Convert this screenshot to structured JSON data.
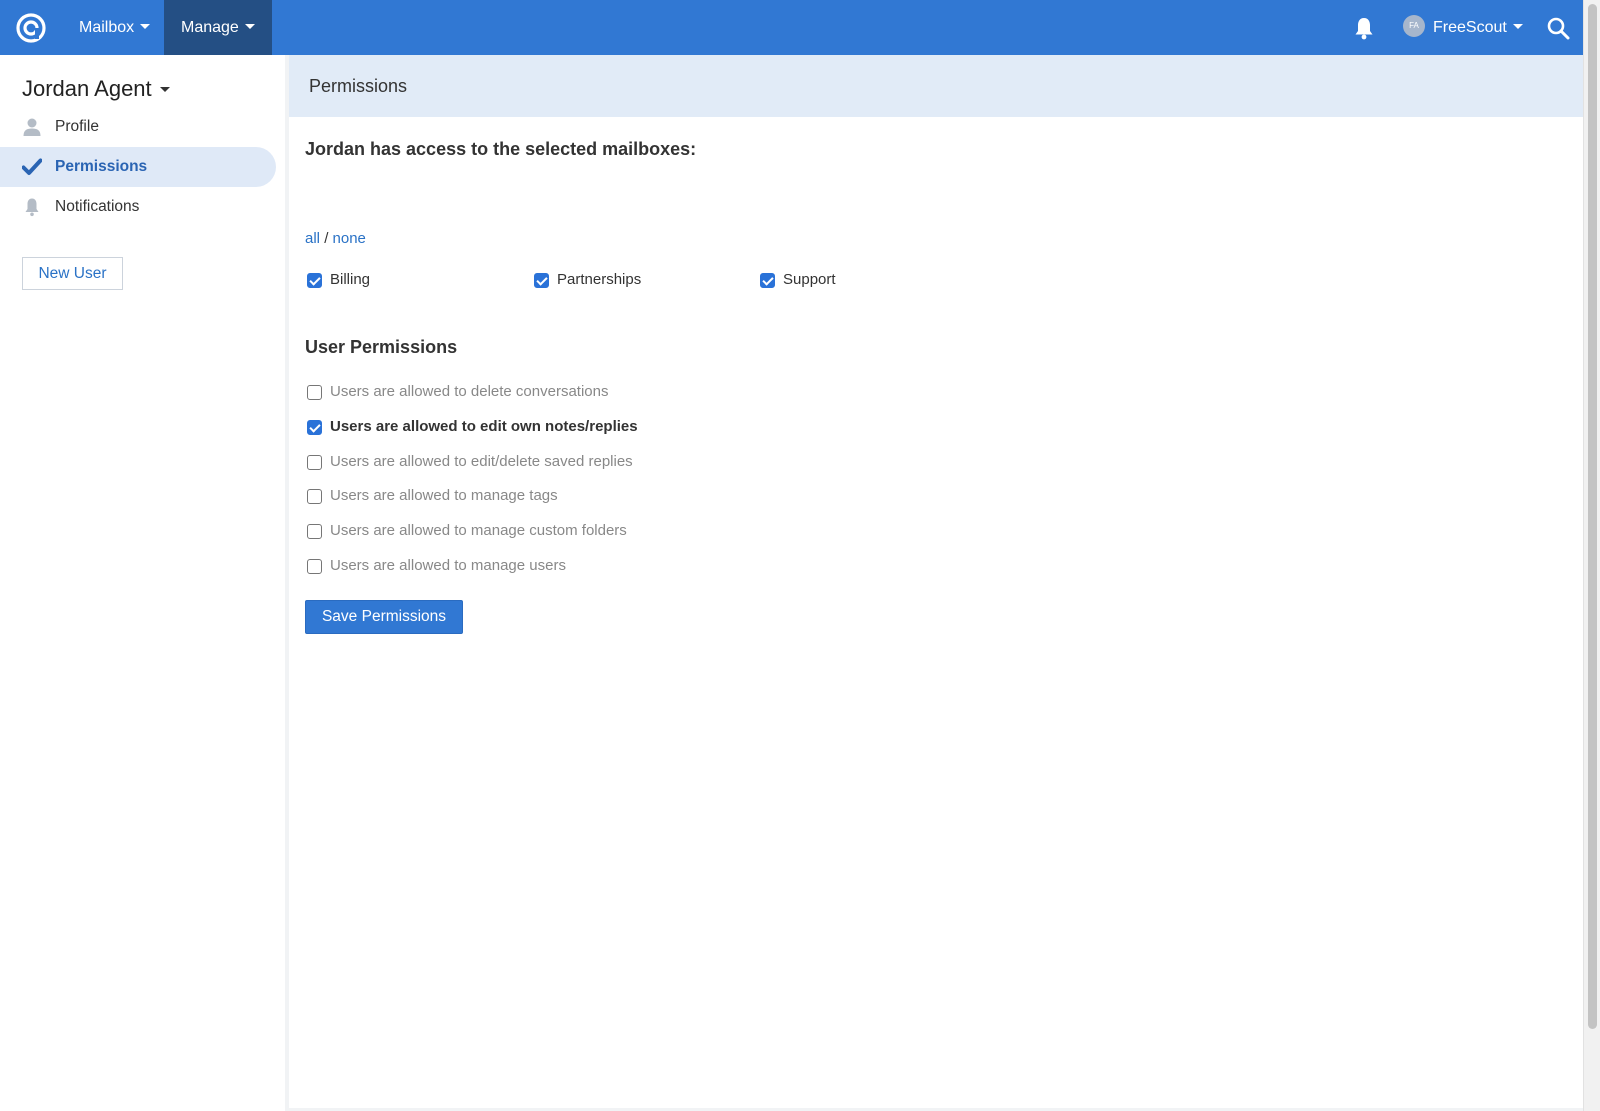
{
  "navbar": {
    "mailbox_label": "Mailbox",
    "manage_label": "Manage",
    "user_initials": "FA",
    "user_name": "FreeScout"
  },
  "sidebar": {
    "title": "Jordan Agent",
    "items": [
      {
        "label": "Profile",
        "icon": "user-icon",
        "active": false
      },
      {
        "label": "Permissions",
        "icon": "checkmark-icon",
        "active": true
      },
      {
        "label": "Notifications",
        "icon": "bell-icon",
        "active": false
      }
    ],
    "new_user_label": "New User"
  },
  "main": {
    "header": "Permissions",
    "mailboxes_heading": "Jordan has access to the selected mailboxes:",
    "all_label": "all",
    "separator": "/",
    "none_label": "none",
    "mailboxes": [
      {
        "label": "Billing",
        "checked": true
      },
      {
        "label": "Partnerships",
        "checked": true
      },
      {
        "label": "Support",
        "checked": true
      }
    ],
    "user_permissions_heading": "User Permissions",
    "permissions": [
      {
        "label": "Users are allowed to delete conversations",
        "checked": false
      },
      {
        "label": "Users are allowed to edit own notes/replies",
        "checked": true
      },
      {
        "label": "Users are allowed to edit/delete saved replies",
        "checked": false
      },
      {
        "label": "Users are allowed to manage tags",
        "checked": false
      },
      {
        "label": "Users are allowed to manage custom folders",
        "checked": false
      },
      {
        "label": "Users are allowed to manage users",
        "checked": false
      }
    ],
    "save_label": "Save Permissions"
  },
  "colors": {
    "navbar": "#3178d3",
    "nav_active": "#244f84",
    "accent": "#2a72d8",
    "sidebar_active_bg": "#dfe9f7",
    "header_bg": "#e1ebf7"
  }
}
